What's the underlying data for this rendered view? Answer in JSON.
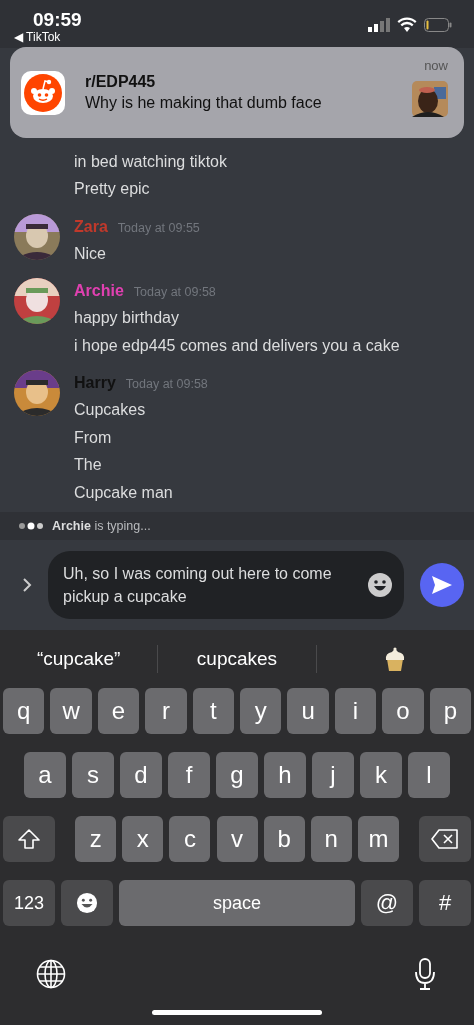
{
  "status_bar": {
    "time": "09:59",
    "back_link": "◀ TikTok"
  },
  "notification": {
    "title": "r/EDP445",
    "body": "Why is he making that dumb face",
    "time": "now",
    "thumbnail": {
      "kind": "picture"
    }
  },
  "messages": [
    {
      "lines": [
        "in bed watching tiktok",
        "Pretty epic"
      ]
    },
    {
      "author": "Zara",
      "color": "#c0392b",
      "timestamp": "Today at 09:55",
      "avatar": {
        "kind": "picture"
      },
      "lines": [
        "Nice"
      ]
    },
    {
      "author": "Archie",
      "color": "#e040b0",
      "timestamp": "Today at 09:58",
      "avatar": {
        "kind": "picture"
      },
      "lines": [
        "happy birthday",
        "i hope edp445 comes and delivers you a cake"
      ]
    },
    {
      "author": "Harry",
      "color": "#111111",
      "timestamp": "Today at 09:58",
      "avatar": {
        "kind": "picture"
      },
      "lines": [
        "Cupcakes",
        "From",
        "The",
        "Cupcake man"
      ]
    }
  ],
  "typing": {
    "text": "**Archie** is typing..."
  },
  "composer": {
    "value": "Uh, so I was coming out here to come pickup a cupcake"
  },
  "suggestions": [
    {
      "kind": "text",
      "label": "“cupcake”"
    },
    {
      "kind": "text",
      "label": "cupcakes"
    },
    {
      "kind": "emoji"
    }
  ],
  "keyboard": {
    "rows": [
      {
        "keys": [
          {
            "kind": "letter",
            "label": "q"
          },
          {
            "kind": "letter",
            "label": "w"
          },
          {
            "kind": "letter",
            "label": "e"
          },
          {
            "kind": "letter",
            "label": "r"
          },
          {
            "kind": "letter",
            "label": "t"
          },
          {
            "kind": "letter",
            "label": "y"
          },
          {
            "kind": "letter",
            "label": "u"
          },
          {
            "kind": "letter",
            "label": "i"
          },
          {
            "kind": "letter",
            "label": "o"
          },
          {
            "kind": "letter",
            "label": "p"
          }
        ]
      },
      {
        "keys": [
          {
            "kind": "letter",
            "label": "a"
          },
          {
            "kind": "letter",
            "label": "s"
          },
          {
            "kind": "letter",
            "label": "d"
          },
          {
            "kind": "letter",
            "label": "f"
          },
          {
            "kind": "letter",
            "label": "g"
          },
          {
            "kind": "letter",
            "label": "h"
          },
          {
            "kind": "letter",
            "label": "j"
          },
          {
            "kind": "letter",
            "label": "k"
          },
          {
            "kind": "letter",
            "label": "l"
          }
        ]
      },
      {
        "keys": [
          {
            "kind": "shift"
          },
          {
            "kind": "letter",
            "label": "z"
          },
          {
            "kind": "letter",
            "label": "x"
          },
          {
            "kind": "letter",
            "label": "c"
          },
          {
            "kind": "letter",
            "label": "v"
          },
          {
            "kind": "letter",
            "label": "b"
          },
          {
            "kind": "letter",
            "label": "n"
          },
          {
            "kind": "letter",
            "label": "m"
          },
          {
            "kind": "delete"
          }
        ]
      },
      {
        "keys": [
          {
            "kind": "numbers",
            "label": "123"
          },
          {
            "kind": "emoji"
          },
          {
            "kind": "space",
            "label": "space"
          },
          {
            "kind": "symbol",
            "label": "@"
          },
          {
            "kind": "symbol",
            "label": "#"
          }
        ]
      }
    ]
  }
}
